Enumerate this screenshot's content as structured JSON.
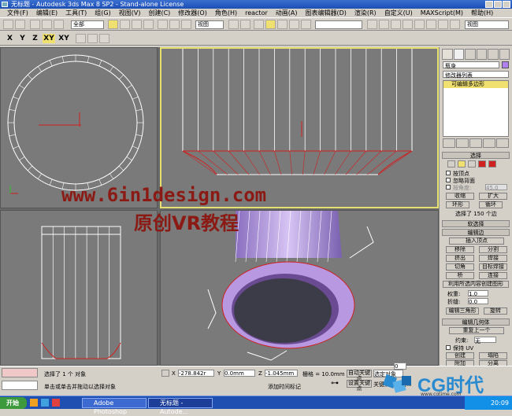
{
  "window": {
    "title": "无标题 - Autodesk 3ds Max 8 SP2 - Stand-alone License"
  },
  "menu": [
    "文件(F)",
    "编辑(E)",
    "工具(T)",
    "组(G)",
    "视图(V)",
    "创建(C)",
    "修改器(O)",
    "角色(H)",
    "reactor",
    "动画(A)",
    "图表编辑器(D)",
    "渲染(R)",
    "自定义(U)",
    "MAXScript(M)",
    "帮助(H)"
  ],
  "toolbar": {
    "selection_filter": "全部",
    "ref_coord": "视图",
    "named_sel": "视图"
  },
  "axis_constraints": [
    "X",
    "Y",
    "Z",
    "XY",
    "XY"
  ],
  "command_panel": {
    "object_name": "瓶身",
    "modifier_list": "修改器列表",
    "stack_item": "可编辑多边形",
    "selection_header": "选择",
    "by_vertex": "按顶点",
    "ignore_backface": "忽略背面",
    "by_angle": "按角度:",
    "angle_value": "45.0",
    "shrink": "收缩",
    "grow": "扩大",
    "ring": "环形",
    "loop": "循环",
    "selected_count": "选择了 150 个边",
    "soft_sel": "软选择",
    "edit_edges": "编辑边",
    "insert_vertex": "插入顶点",
    "remove": "移除",
    "split": "分割",
    "extrude": "挤出",
    "weld": "焊接",
    "chamfer": "切角",
    "target_weld": "目标焊接",
    "bridge": "桥",
    "connect": "连接",
    "create_shape": "利用所选内容创建图形",
    "weight_label": "权重:",
    "weight_value": "1.0",
    "crease_label": "折缝:",
    "crease_value": "0.0",
    "edit_tri": "编辑三角形",
    "turn": "旋转",
    "edit_geo": "编辑几何体",
    "repeat_last": "重复上一个",
    "constraints_label": "约束:",
    "constraints_value": "无",
    "preserve_uv": "保持 UV",
    "create": "创建",
    "collapse": "塌陷",
    "attach": "附加",
    "detach": "分离"
  },
  "status": {
    "selected": "选择了 1 个 对象",
    "prompt": "单击或单击并拖动以选择对象",
    "x_label": "X",
    "x_value": "-278.842r",
    "y_label": "Y",
    "y_value": "0.0mm",
    "z_label": "Z",
    "z_value": "-1.045mm",
    "grid": "栅格 = 10.0mm",
    "add_time_tag": "添加时间标记",
    "auto_key": "自动关键点",
    "set_key": "设置关键点",
    "key_filter": "关键点过滤器...",
    "sel_dropdown": "选定对象",
    "frame_value": "0"
  },
  "taskbar": {
    "start": "开始",
    "tasks": [
      "Adobe Photoshop",
      "无标题 - Autode..."
    ],
    "clock": "20:09"
  },
  "watermark": {
    "url": "www.6in1design.com",
    "cn": "原创VR教程"
  },
  "logo": {
    "text": "CG时代",
    "sub": "www.cgtime.com"
  },
  "colors": {
    "wire": "#ffffff",
    "edge_sel": "#d02020",
    "active_border": "#e6e070",
    "object": "#b898e0"
  }
}
